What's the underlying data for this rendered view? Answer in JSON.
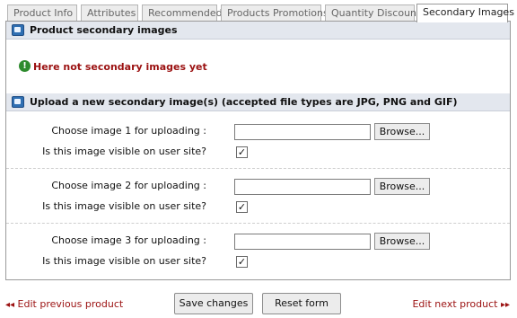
{
  "tabs": [
    {
      "label": "Product Info",
      "active": false
    },
    {
      "label": "Attributes",
      "active": false
    },
    {
      "label": "Recommended",
      "active": false
    },
    {
      "label": "Products Promotions",
      "active": false
    },
    {
      "label": "Quantity Discounts",
      "active": false
    },
    {
      "label": "Secondary Images",
      "active": true
    }
  ],
  "secondary_section": {
    "title": "Product secondary images",
    "empty_message": "Here not secondary images yet"
  },
  "upload_section": {
    "title": "Upload a new secondary image(s) (accepted file types are JPG, PNG and GIF)",
    "rows": [
      {
        "choose_label": "Choose image 1 for uploading :",
        "file_value": "",
        "browse_label": "Browse...",
        "visible_label": "Is this image visible on user site?",
        "visible_checked": true
      },
      {
        "choose_label": "Choose image 2 for uploading :",
        "file_value": "",
        "browse_label": "Browse...",
        "visible_label": "Is this image visible on user site?",
        "visible_checked": true
      },
      {
        "choose_label": "Choose image 3 for uploading :",
        "file_value": "",
        "browse_label": "Browse...",
        "visible_label": "Is this image visible on user site?",
        "visible_checked": true
      }
    ]
  },
  "footer": {
    "prev_link": "Edit previous product",
    "save_button": "Save changes",
    "reset_button": "Reset form",
    "next_link": "Edit next product"
  },
  "icons": {
    "section_icon": "image-frame-icon",
    "info_icon": "info-circle-icon",
    "prev_arrow": "double-left-arrow-icon",
    "next_arrow": "double-right-arrow-icon"
  },
  "colors": {
    "error_text": "#9b1111",
    "header_bg": "#e3e7ee",
    "active_tab_bg": "#ffffff",
    "inactive_tab_bg": "#ececec"
  }
}
